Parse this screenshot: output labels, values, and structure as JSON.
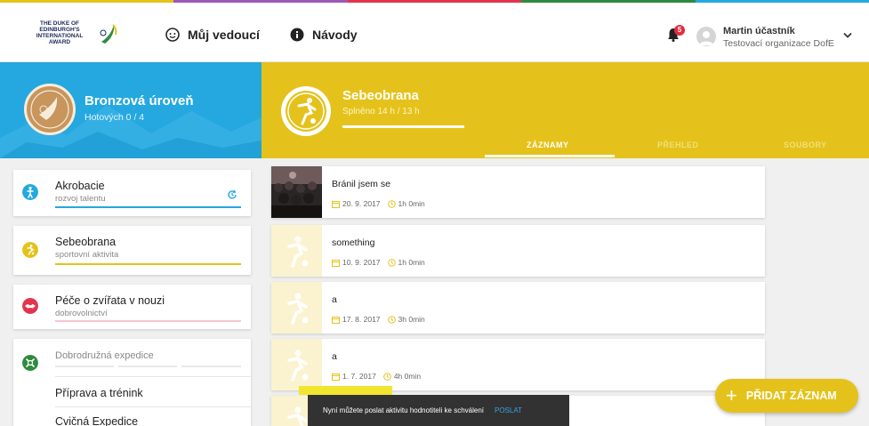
{
  "colors": {
    "accent_yellow": "#e5c21b",
    "accent_blue": "#24a8df",
    "accent_red": "#e22b3c",
    "green": "#2e8b3d",
    "pink": "#e3344e"
  },
  "header": {
    "logo_line1": "THE DUKE OF EDINBURGH'S",
    "logo_line2": "INTERNATIONAL AWARD",
    "nav": [
      {
        "label": "Můj vedoucí",
        "icon": "smiley-icon"
      },
      {
        "label": "Návody",
        "icon": "info-icon"
      }
    ],
    "notifications_count": "5",
    "user_name": "Martin účastník",
    "user_org": "Testovací organizace DofE"
  },
  "level": {
    "title": "Bronzová úroveň",
    "subtitle": "Hotových 0 / 4"
  },
  "activity": {
    "title": "Sebeobrana",
    "subtitle": "Splněno 14 h / 13 h",
    "progress": 1.0,
    "tabs": [
      "ZÁZNAMY",
      "PŘEHLED",
      "SOUBORY"
    ],
    "active_tab": "ZÁZNAMY"
  },
  "sidebar": {
    "sections": [
      {
        "title": "Akrobacie",
        "subtitle": "rozvoj talentu",
        "color": "#24a8df",
        "icon": "acrobat-icon"
      },
      {
        "title": "Sebeobrana",
        "subtitle": "sportovní aktivita",
        "color": "#e5c21b",
        "icon": "sport-icon"
      },
      {
        "title": "Péče o zvířata v nouzi",
        "subtitle": "dobrovolnictví",
        "color": "#f7c6cf",
        "icon": "handshake-icon"
      }
    ],
    "expedition": {
      "title": "Dobrodružná expedice",
      "items": [
        "Příprava a trénink",
        "Cvičná Expedice"
      ]
    }
  },
  "records": [
    {
      "title": "Bránil jsem se",
      "date": "20. 9. 2017",
      "duration": "1h 0min",
      "thumb": "photo"
    },
    {
      "title": "something",
      "date": "10. 9. 2017",
      "duration": "1h 0min",
      "thumb": "icon"
    },
    {
      "title": "a",
      "date": "17. 8. 2017",
      "duration": "3h 0min",
      "thumb": "icon"
    },
    {
      "title": "a",
      "date": "1. 7. 2017",
      "duration": "4h 0min",
      "thumb": "icon"
    }
  ],
  "fab": {
    "label": "PŘIDAT ZÁZNAM"
  },
  "snackbar": {
    "text": "Nyní můžete poslat aktivitu hodnotiteli ke schválení",
    "action": "POSLAT"
  }
}
